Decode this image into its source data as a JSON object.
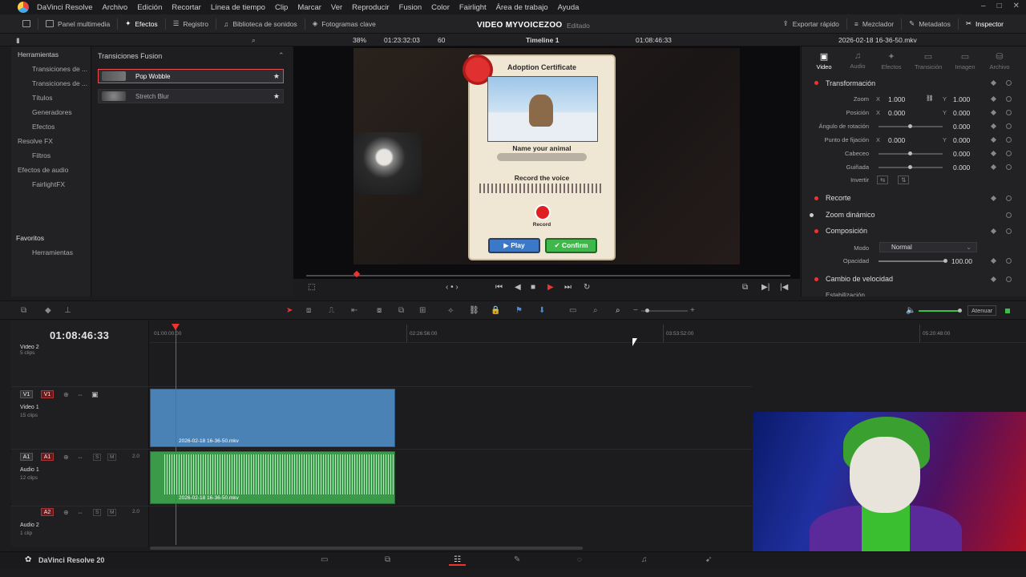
{
  "app": {
    "title": "DaVinci Resolve",
    "menu": [
      "Archivo",
      "Edición",
      "Recortar",
      "Línea de tiempo",
      "Clip",
      "Marcar",
      "Ver",
      "Reproducir",
      "Fusion",
      "Color",
      "Fairlight",
      "Área de trabajo",
      "Ayuda"
    ]
  },
  "toolbar": {
    "media_pool": "Panel multimedia",
    "effects": "Efectos",
    "index": "Registro",
    "sound_library": "Biblioteca de sonidos",
    "keyframes": "Fotogramas clave",
    "project_title": "VIDEO MYVOICEZOO",
    "project_status": "Editado",
    "quick_export": "Exportar rápido",
    "mixer": "Mezclador",
    "metadata": "Metadatos",
    "inspector": "Inspector"
  },
  "viewer_bar": {
    "zoom": "38%",
    "timecode": "01:23:32:03",
    "fps": "60",
    "timeline_name": "Timeline 1",
    "current_tc": "01:08:46:33",
    "clip_name": "2026-02-18 16-36-50.mkv"
  },
  "effects_library": {
    "tree": [
      "Herramientas",
      "Transiciones de ...",
      "Transiciones de ...",
      "Títulos",
      "Generadores",
      "Efectos",
      "Resolve FX",
      "Filtros",
      "Efectos de audio",
      "FairlightFX"
    ],
    "favorites_header": "Favoritos",
    "favorites_items": [
      "Herramientas"
    ],
    "panel_header": "Transiciones Fusion",
    "items": [
      {
        "label": "Pop Wobble",
        "selected": true
      },
      {
        "label": "Stretch Blur",
        "selected": false
      }
    ]
  },
  "video_frame": {
    "card_title": "Adoption Certificate",
    "name_label": "Name your animal",
    "record_label": "Record the voice",
    "record_btn": "Record",
    "play_btn": "▶ Play",
    "confirm_btn": "✔ Confirm"
  },
  "inspector": {
    "tabs": [
      "Video",
      "Audio",
      "Efectos",
      "Transición",
      "Imagen",
      "Archivo"
    ],
    "transform": "Transformación",
    "zoom_label": "Zoom",
    "zoom_x": "1.000",
    "zoom_y": "1.000",
    "position_label": "Posición",
    "pos_x": "0.000",
    "pos_y": "0.000",
    "rotation_label": "Ángulo de rotación",
    "rotation": "0.000",
    "anchor_label": "Punto de fijación",
    "anchor_x": "0.000",
    "anchor_y": "0.000",
    "pitch_label": "Cabeceo",
    "pitch": "0.000",
    "yaw_label": "Guiñada",
    "yaw": "0.000",
    "flip_label": "Invertir",
    "crop": "Recorte",
    "dynamic_zoom": "Zoom dinámico",
    "composite": "Composición",
    "mode_label": "Modo",
    "mode_value": "Normal",
    "opacity_label": "Opacidad",
    "opacity": "100.00",
    "speed_change": "Cambio de velocidad",
    "stabilization": "Estabilización"
  },
  "timeline": {
    "timecode": "01:08:46:33",
    "ruler": [
      "01:00:00:00",
      "02:26:56:00",
      "03:53:52:00",
      "05:20:48:00"
    ],
    "attenuate": "Atenuar",
    "tracks": [
      {
        "id": "V2",
        "name": "Video 2",
        "clips": "5 clips"
      },
      {
        "id": "V1",
        "name": "Video 1",
        "clips": "15 clips"
      },
      {
        "id": "A1",
        "name": "Audio 1",
        "clips": "12 clips",
        "gain": "2.0"
      },
      {
        "id": "A2",
        "name": "Audio 2",
        "clips": "1 clip",
        "gain": "2.0"
      }
    ],
    "video_clip": "2026-02-18 16-36-50.mkv",
    "audio_clip": "2026-02-18 16-36-50.mkv"
  },
  "bottom": {
    "product": "DaVinci Resolve 20"
  }
}
